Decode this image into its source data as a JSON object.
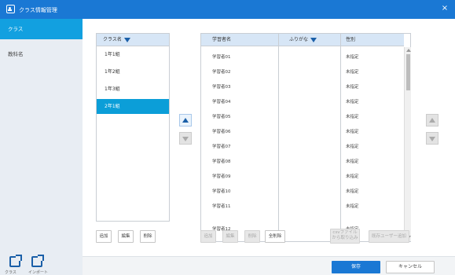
{
  "window": {
    "title": "クラス情報管理",
    "close_glyph": "×"
  },
  "sidebar": {
    "items": [
      {
        "label": "クラス"
      },
      {
        "label": "教科名"
      }
    ],
    "footer": [
      {
        "icon": "export-icon",
        "label": "クラス"
      },
      {
        "icon": "import-icon",
        "label": "インポート"
      }
    ]
  },
  "class_list": {
    "header": "クラス名",
    "items": [
      "1年1組",
      "1年2組",
      "1年3組",
      "2年1組"
    ],
    "selected_index": 3,
    "buttons": {
      "add": "追加",
      "edit": "編集",
      "delete": "削除"
    }
  },
  "student_table": {
    "columns": [
      "学習者名",
      "ふりがな",
      "性別"
    ],
    "rows": [
      {
        "name": "学習者01",
        "kana": "",
        "gender": "未指定"
      },
      {
        "name": "学習者02",
        "kana": "",
        "gender": "未指定"
      },
      {
        "name": "学習者03",
        "kana": "",
        "gender": "未指定"
      },
      {
        "name": "学習者04",
        "kana": "",
        "gender": "未指定"
      },
      {
        "name": "学習者05",
        "kana": "",
        "gender": "未指定"
      },
      {
        "name": "学習者06",
        "kana": "",
        "gender": "未指定"
      },
      {
        "name": "学習者07",
        "kana": "",
        "gender": "未指定"
      },
      {
        "name": "学習者08",
        "kana": "",
        "gender": "未指定"
      },
      {
        "name": "学習者09",
        "kana": "",
        "gender": "未指定"
      },
      {
        "name": "学習者10",
        "kana": "",
        "gender": "未指定"
      },
      {
        "name": "学習者11",
        "kana": "",
        "gender": "未指定"
      },
      {
        "name": "学習者12",
        "kana": "",
        "gender": "未指定"
      }
    ],
    "buttons": {
      "add": "追加",
      "edit": "編集",
      "delete": "削除",
      "delete_all": "全削除",
      "csv_line1": "csvファイル",
      "csv_line2": "から取り込み",
      "existing_user": "既存ユーザー追加"
    }
  },
  "footer": {
    "save": "保存",
    "cancel": "キャンセル"
  },
  "colors": {
    "accent": "#1a78d4",
    "selected": "#0b9ed8",
    "sidebar_bg": "#e8edf3"
  }
}
